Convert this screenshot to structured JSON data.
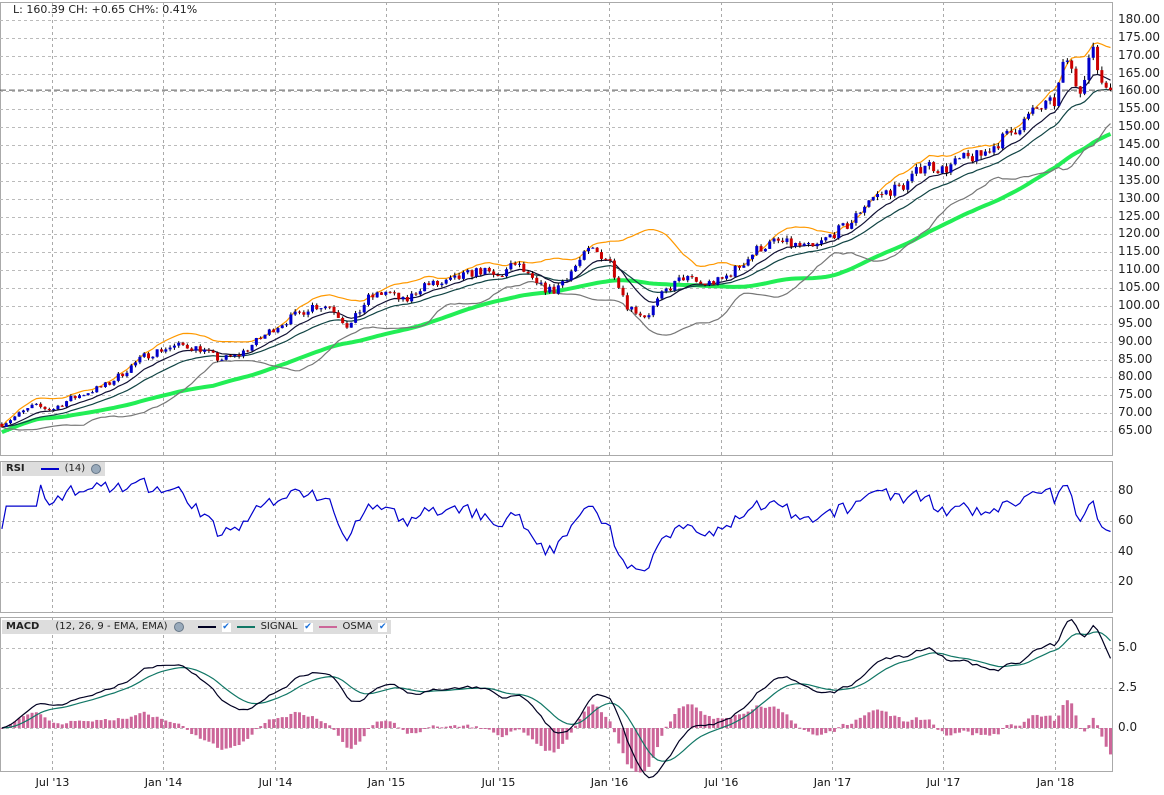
{
  "header": {
    "quote": "L: 160.39 CH: +0.65 CH%: 0.41%"
  },
  "rsi_panel": {
    "title": "RSI",
    "params": "(14)"
  },
  "macd_panel": {
    "title": "MACD",
    "params": "(12, 26, 9 - EMA, EMA)",
    "signal_label": "SIGNAL",
    "osma_label": "OSMA"
  },
  "colors": {
    "up": "#0000cc",
    "down": "#cc0000",
    "upper_band": "#ff9900",
    "lower_band": "#777777",
    "ema_fast": "#111133",
    "ema_slow": "#114444",
    "sma_long": "#22ee55",
    "rsi": "#0000cc",
    "macd": "#000022",
    "signal": "#117766",
    "osma": "#cc6699"
  },
  "chart_data": [
    {
      "type": "candlestick",
      "title": "Price",
      "last": 160.39,
      "ylim": [
        60,
        182
      ],
      "yticks": [
        65,
        70,
        75,
        80,
        85,
        90,
        95,
        100,
        105,
        110,
        115,
        120,
        125,
        130,
        135,
        140,
        145,
        150,
        155,
        160,
        165,
        170,
        175,
        180
      ],
      "xunit": "months since Jan 2013",
      "xlim": [
        3.2,
        63
      ],
      "xticks": [
        {
          "m": 6,
          "label": "Jul '13"
        },
        {
          "m": 12,
          "label": "Jan '14"
        },
        {
          "m": 18,
          "label": "Jul '14"
        },
        {
          "m": 24,
          "label": "Jan '15"
        },
        {
          "m": 30,
          "label": "Jul '15"
        },
        {
          "m": 36,
          "label": "Jan '16"
        },
        {
          "m": 42,
          "label": "Jul '16"
        },
        {
          "m": 48,
          "label": "Jan '17"
        },
        {
          "m": 54,
          "label": "Jul '17"
        },
        {
          "m": 60,
          "label": "Jan '18"
        }
      ],
      "monthly_close": [
        [
          3.3,
          67
        ],
        [
          4,
          69
        ],
        [
          5,
          72
        ],
        [
          6,
          71
        ],
        [
          7,
          74
        ],
        [
          8,
          76
        ],
        [
          9,
          78
        ],
        [
          10,
          82
        ],
        [
          11,
          86
        ],
        [
          12,
          88
        ],
        [
          13,
          89
        ],
        [
          14,
          88
        ],
        [
          15,
          85
        ],
        [
          16,
          86
        ],
        [
          17,
          90
        ],
        [
          18,
          94
        ],
        [
          19,
          97
        ],
        [
          20,
          100
        ],
        [
          21,
          100
        ],
        [
          22,
          94
        ],
        [
          23,
          102
        ],
        [
          24,
          104
        ],
        [
          25,
          101
        ],
        [
          26,
          106
        ],
        [
          27,
          106
        ],
        [
          28,
          108
        ],
        [
          29,
          110
        ],
        [
          30,
          108
        ],
        [
          31,
          112
        ],
        [
          32,
          106
        ],
        [
          33,
          104
        ],
        [
          34,
          110
        ],
        [
          35,
          116
        ],
        [
          36,
          113
        ],
        [
          37,
          100
        ],
        [
          38,
          97
        ],
        [
          39,
          104
        ],
        [
          40,
          108
        ],
        [
          41,
          106
        ],
        [
          42,
          107
        ],
        [
          43,
          111
        ],
        [
          44,
          116
        ],
        [
          45,
          118
        ],
        [
          46,
          117
        ],
        [
          47,
          116
        ],
        [
          48,
          120
        ],
        [
          49,
          123
        ],
        [
          50,
          130
        ],
        [
          51,
          132
        ],
        [
          52,
          134
        ],
        [
          53,
          140
        ],
        [
          54,
          138
        ],
        [
          55,
          141
        ],
        [
          56,
          142
        ],
        [
          57,
          146
        ],
        [
          58,
          150
        ],
        [
          59,
          155
        ],
        [
          60,
          157
        ],
        [
          60.6,
          170
        ],
        [
          61.3,
          160
        ],
        [
          62,
          172
        ],
        [
          62.5,
          163
        ],
        [
          63,
          160.39
        ]
      ]
    },
    {
      "type": "line",
      "title": "RSI",
      "params": "(14)",
      "ylim": [
        0,
        100
      ],
      "yticks": [
        20,
        40,
        60,
        80
      ]
    },
    {
      "type": "line+bar",
      "title": "MACD",
      "params": "(12, 26, 9 - EMA, EMA)",
      "ylim": [
        -2.6,
        7
      ],
      "yticks": [
        0.0,
        2.5,
        5.0
      ],
      "series": [
        "MACD",
        "SIGNAL",
        "OSMA"
      ]
    }
  ]
}
